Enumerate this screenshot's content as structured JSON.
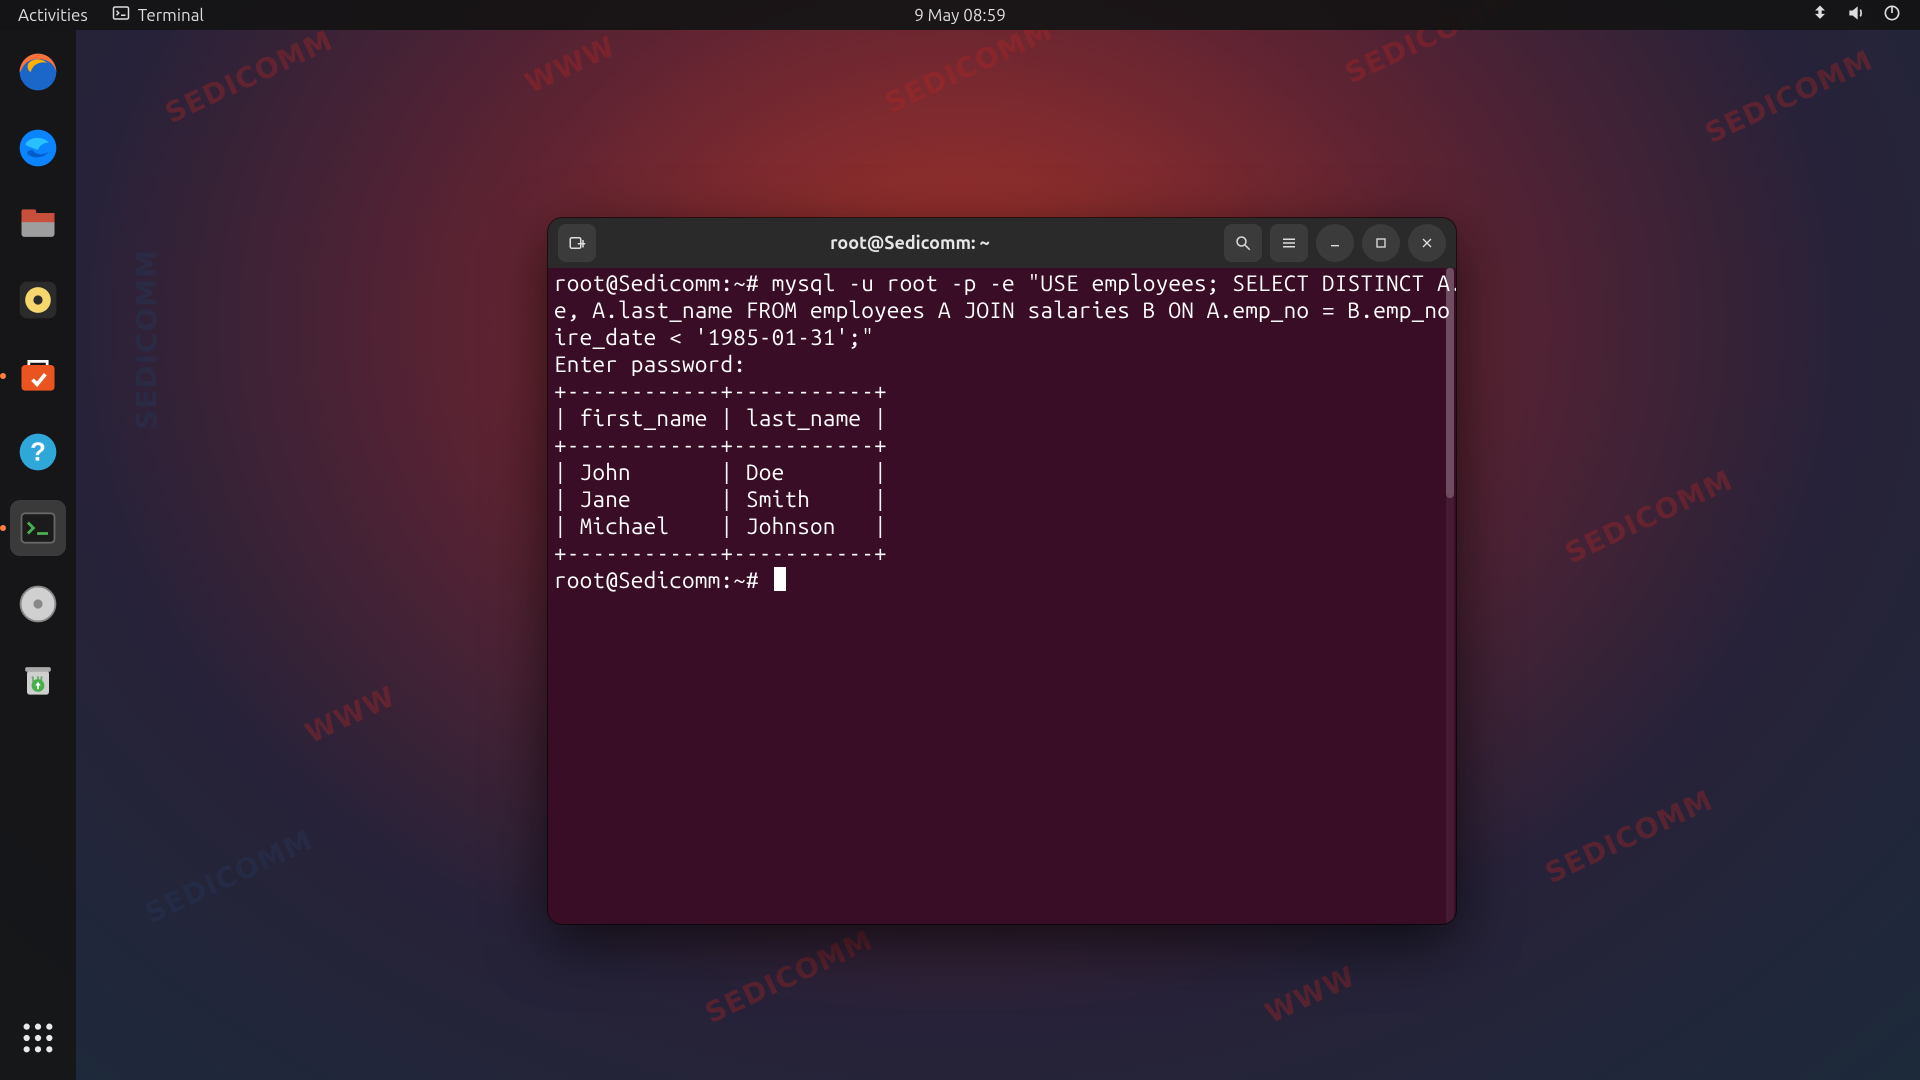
{
  "topbar": {
    "activities": "Activities",
    "app_name": "Terminal",
    "datetime": "9 May  08:59"
  },
  "dock": {
    "items": [
      {
        "name": "firefox-icon"
      },
      {
        "name": "thunderbird-icon"
      },
      {
        "name": "files-icon"
      },
      {
        "name": "rhythmbox-icon"
      },
      {
        "name": "software-icon"
      },
      {
        "name": "help-icon"
      },
      {
        "name": "terminal-icon"
      },
      {
        "name": "disk-icon"
      },
      {
        "name": "trash-icon"
      }
    ]
  },
  "window": {
    "title": "root@Sedicomm: ~"
  },
  "terminal": {
    "prompt1": "root@Sedicomm:~# ",
    "cmd_wrapped_l1": "mysql -u root -p -e \"USE employees; SELECT DISTINCT A.first_nam",
    "cmd_wrapped_l2": "e, A.last_name FROM employees A JOIN salaries B ON A.emp_no = B.emp_no WHERE A.h",
    "cmd_wrapped_l3": "ire_date < '1985-01-31';\"",
    "enter_pw": "Enter password:",
    "sep": "+------------+-----------+",
    "header": "| first_name | last_name |",
    "rows": [
      "| John       | Doe       |",
      "| Jane       | Smith     |",
      "| Michael    | Johnson   |"
    ],
    "prompt2": "root@Sedicomm:~# "
  }
}
